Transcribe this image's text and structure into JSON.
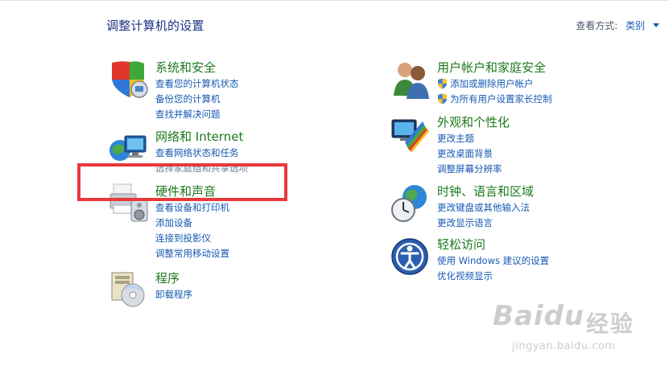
{
  "page": {
    "title": "调整计算机的设置",
    "view_by_label": "查看方式:",
    "view_by_value": "类别"
  },
  "left_categories": [
    {
      "title": "系统和安全",
      "icon": "shield-computer-icon",
      "links": [
        "查看您的计算机状态",
        "备份您的计算机",
        "查找并解决问题"
      ]
    },
    {
      "title": "网络和 Internet",
      "icon": "network-globe-icon",
      "links": [
        "查看网络状态和任务",
        "选择家庭组和共享选项"
      ]
    },
    {
      "title": "硬件和声音",
      "icon": "printer-speaker-icon",
      "links": [
        "查看设备和打印机",
        "添加设备",
        "连接到投影仪",
        "调整常用移动设置"
      ]
    },
    {
      "title": "程序",
      "icon": "programs-disc-icon",
      "links": [
        "卸载程序"
      ]
    }
  ],
  "right_categories": [
    {
      "title": "用户帐户和家庭安全",
      "icon": "users-icon",
      "links": [
        "添加或删除用户帐户",
        "为所有用户设置家长控制"
      ]
    },
    {
      "title": "外观和个性化",
      "icon": "monitor-palette-icon",
      "links": [
        "更改主题",
        "更改桌面背景",
        "调整屏幕分辨率"
      ]
    },
    {
      "title": "时钟、语言和区域",
      "icon": "clock-globe-icon",
      "links": [
        "更改键盘或其他输入法",
        "更改显示语言"
      ]
    },
    {
      "title": "轻松访问",
      "icon": "ease-of-access-icon",
      "links": [
        "使用 Windows 建议的设置",
        "优化视频显示"
      ]
    }
  ],
  "watermark": {
    "logo": "Baidu",
    "cn": "经验",
    "url": "jingyan.baidu.com"
  },
  "colors": {
    "title": "#1e3287",
    "category": "#1c7a1c",
    "link": "#1659b3",
    "highlight": "#e8383b"
  }
}
